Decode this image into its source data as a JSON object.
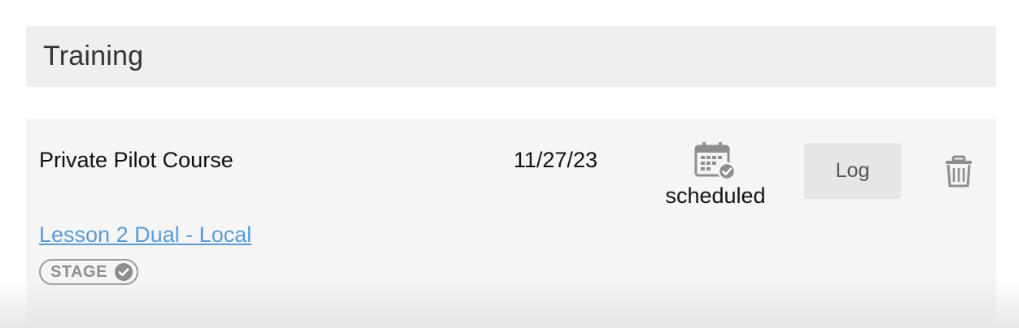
{
  "section": {
    "title": "Training"
  },
  "entry": {
    "course": "Private Pilot Course",
    "date": "11/27/23",
    "status": {
      "label": "scheduled",
      "icon": "calendar-check-icon"
    },
    "log_button": "Log",
    "delete_icon": "trash-icon",
    "lesson_link": "Lesson 2 Dual - Local",
    "badge": {
      "label": "STAGE",
      "icon": "check-circle-icon"
    }
  },
  "colors": {
    "header_bg": "#efefef",
    "card_bg": "#f5f5f5",
    "link": "#5b9bd5",
    "muted_icon": "#8e8e8e",
    "button_bg": "#e6e6e6"
  }
}
